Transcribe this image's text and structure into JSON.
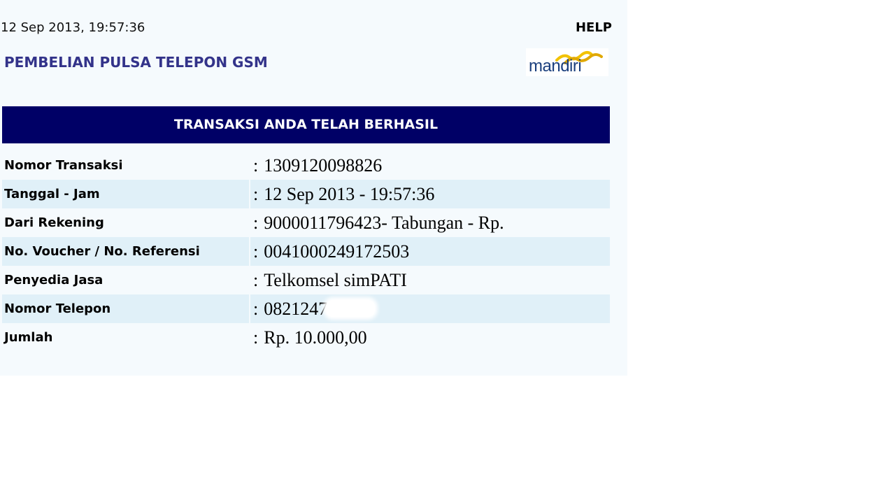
{
  "header": {
    "timestamp": "12 Sep 2013, 19:57:36",
    "help_label": "HELP",
    "title": "PEMBELIAN PULSA TELEPON GSM",
    "logo_text": "mandiri"
  },
  "banner": {
    "text": "TRANSAKSI ANDA TELAH BERHASIL"
  },
  "separator": ":",
  "details": [
    {
      "label": "Nomor Transaksi",
      "value": "1309120098826"
    },
    {
      "label": "Tanggal - Jam",
      "value": "12 Sep 2013 - 19:57:36"
    },
    {
      "label": "Dari Rekening",
      "value": "9000011796423- Tabungan - Rp."
    },
    {
      "label": "No. Voucher / No. Referensi",
      "value": "0041000249172503"
    },
    {
      "label": "Penyedia Jasa",
      "value": "Telkomsel simPATI"
    },
    {
      "label": "Nomor Telepon",
      "value": "0821247"
    },
    {
      "label": "Jumlah",
      "value": "Rp. 10.000,00"
    }
  ],
  "colors": {
    "banner_bg": "#000066",
    "title_color": "#33338a",
    "row_alt_bg": "#e0f0f8",
    "panel_bg": "#f5fafd",
    "logo_wave": "#f2c200",
    "logo_text": "#1b3f7d"
  }
}
